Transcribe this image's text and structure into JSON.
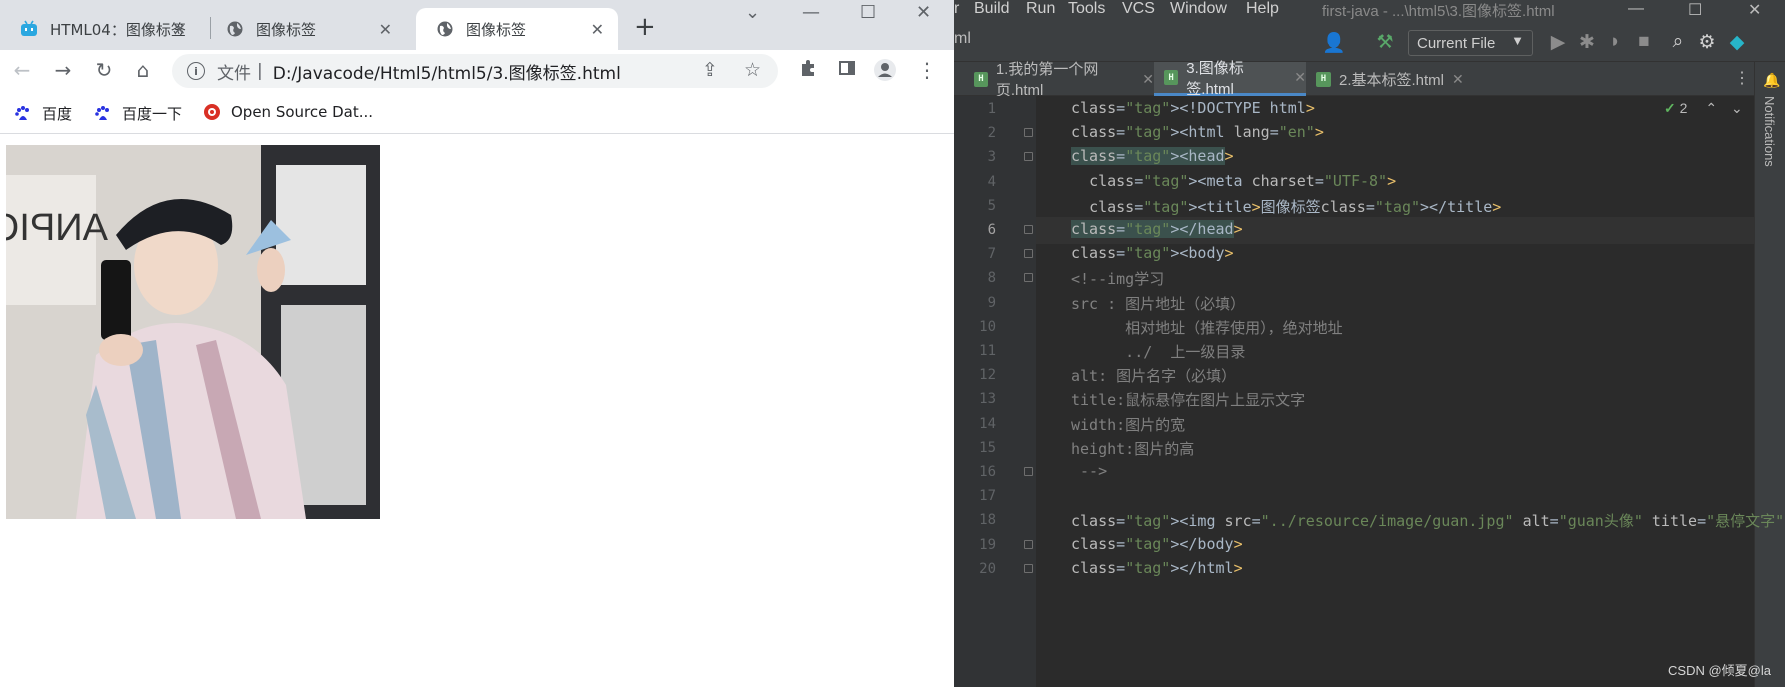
{
  "browser": {
    "tabs": [
      {
        "label": "HTML04：图像标签",
        "active": false
      },
      {
        "label": "图像标签",
        "active": false
      },
      {
        "label": "图像标签",
        "active": true
      }
    ],
    "new_tab_glyph": "+",
    "address": {
      "scheme_label": "文件",
      "separator": "|",
      "url": "D:/Javacode/Html5/html5/3.图像标签.html"
    },
    "bookmarks": [
      {
        "label": "百度"
      },
      {
        "label": "百度一下"
      },
      {
        "label": "Open Source Dat..."
      }
    ],
    "brand_colors": {
      "baidu": "#2932e1",
      "osd": "#d93025"
    }
  },
  "ide": {
    "menu": [
      "Build",
      "Run",
      "Tools",
      "VCS",
      "Window",
      "Help"
    ],
    "window_title": "first-java - ...\\html5\\3.图像标签.html",
    "left_fragment": "r",
    "toolbar_left_fragment": "ml",
    "run_config": "Current File",
    "editor_tabs": [
      {
        "label": "1.我的第一个网页.html",
        "active": false
      },
      {
        "label": "3.图像标签.html",
        "active": true
      },
      {
        "label": "2.基本标签.html",
        "active": false
      }
    ],
    "notifications_label": "Notifications",
    "inspection_count": "2",
    "current_line": 6,
    "code_lines": [
      {
        "n": "1",
        "t": "<!DOCTYPE html>"
      },
      {
        "n": "2",
        "t": "<html lang=\"en\">"
      },
      {
        "n": "3",
        "t": "<head>"
      },
      {
        "n": "4",
        "t": "  <meta charset=\"UTF-8\">"
      },
      {
        "n": "5",
        "t": "  <title>图像标签</title>"
      },
      {
        "n": "6",
        "t": "</head>"
      },
      {
        "n": "7",
        "t": "<body>"
      },
      {
        "n": "8",
        "t": "<!--img学习"
      },
      {
        "n": "9",
        "t": "src : 图片地址（必填）"
      },
      {
        "n": "10",
        "t": "      相对地址（推荐使用），绝对地址"
      },
      {
        "n": "11",
        "t": "      ../  上一级目录"
      },
      {
        "n": "12",
        "t": "alt: 图片名字（必填）"
      },
      {
        "n": "13",
        "t": "title:鼠标悬停在图片上显示文字"
      },
      {
        "n": "14",
        "t": "width:图片的宽"
      },
      {
        "n": "15",
        "t": "height:图片的高"
      },
      {
        "n": "16",
        "t": " -->"
      },
      {
        "n": "17",
        "t": ""
      },
      {
        "n": "18",
        "t": "<img src=\"../resource/image/guan.jpg\" alt=\"guan头像\" title=\"悬停文字\" heig"
      },
      {
        "n": "19",
        "t": "</body>"
      },
      {
        "n": "20",
        "t": "</html>"
      }
    ],
    "syntax_colors": {
      "tag": "#e8bf6a",
      "value": "#6a8759",
      "comment": "#808080",
      "text": "#a9b7c6"
    }
  },
  "watermark": "CSDN @倾夏@la"
}
